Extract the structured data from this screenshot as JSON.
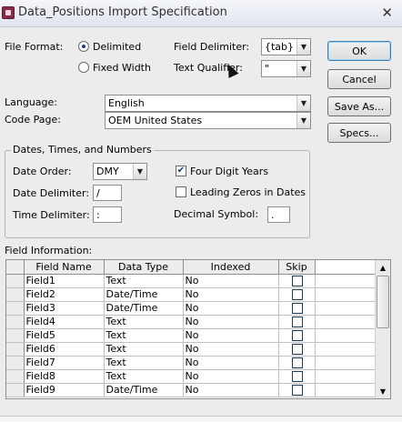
{
  "window": {
    "title": "Data_Positions Import Specification",
    "close_glyph": "✕"
  },
  "file_format": {
    "label": "File Format:",
    "options": [
      {
        "label": "Delimited",
        "selected": true
      },
      {
        "label": "Fixed Width",
        "selected": false
      }
    ]
  },
  "field_delimiter": {
    "label": "Field Delimiter:",
    "value": "{tab}"
  },
  "text_qualifier": {
    "label": "Text Qualifier:",
    "value": "\""
  },
  "language": {
    "label": "Language:",
    "value": "English"
  },
  "code_page": {
    "label": "Code Page:",
    "value": "OEM United States"
  },
  "dates_group": {
    "label": "Dates, Times, and Numbers",
    "date_order": {
      "label": "Date Order:",
      "value": "DMY"
    },
    "date_delimiter": {
      "label": "Date Delimiter:",
      "value": "/"
    },
    "time_delimiter": {
      "label": "Time Delimiter:",
      "value": ":"
    },
    "four_digit_years": {
      "label": "Four Digit Years",
      "checked": true
    },
    "leading_zeros": {
      "label": "Leading Zeros in Dates",
      "checked": false
    },
    "decimal_symbol": {
      "label": "Decimal Symbol:",
      "value": "."
    }
  },
  "buttons": {
    "ok": "OK",
    "cancel": "Cancel",
    "save_as": "Save As...",
    "specs": "Specs..."
  },
  "field_info": {
    "label": "Field Information:",
    "columns": [
      "Field Name",
      "Data Type",
      "Indexed",
      "Skip"
    ],
    "rows": [
      {
        "name": "Field1",
        "type": "Text",
        "indexed": "No",
        "skip": false
      },
      {
        "name": "Field2",
        "type": "Date/Time",
        "indexed": "No",
        "skip": false
      },
      {
        "name": "Field3",
        "type": "Date/Time",
        "indexed": "No",
        "skip": false
      },
      {
        "name": "Field4",
        "type": "Text",
        "indexed": "No",
        "skip": false
      },
      {
        "name": "Field5",
        "type": "Text",
        "indexed": "No",
        "skip": false
      },
      {
        "name": "Field6",
        "type": "Text",
        "indexed": "No",
        "skip": false
      },
      {
        "name": "Field7",
        "type": "Text",
        "indexed": "No",
        "skip": false
      },
      {
        "name": "Field8",
        "type": "Text",
        "indexed": "No",
        "skip": false
      },
      {
        "name": "Field9",
        "type": "Date/Time",
        "indexed": "No",
        "skip": false
      }
    ]
  },
  "icons": {
    "combo_arrow": "▼",
    "scroll_up": "▲",
    "scroll_down": "▼",
    "check_mark": "✔"
  }
}
